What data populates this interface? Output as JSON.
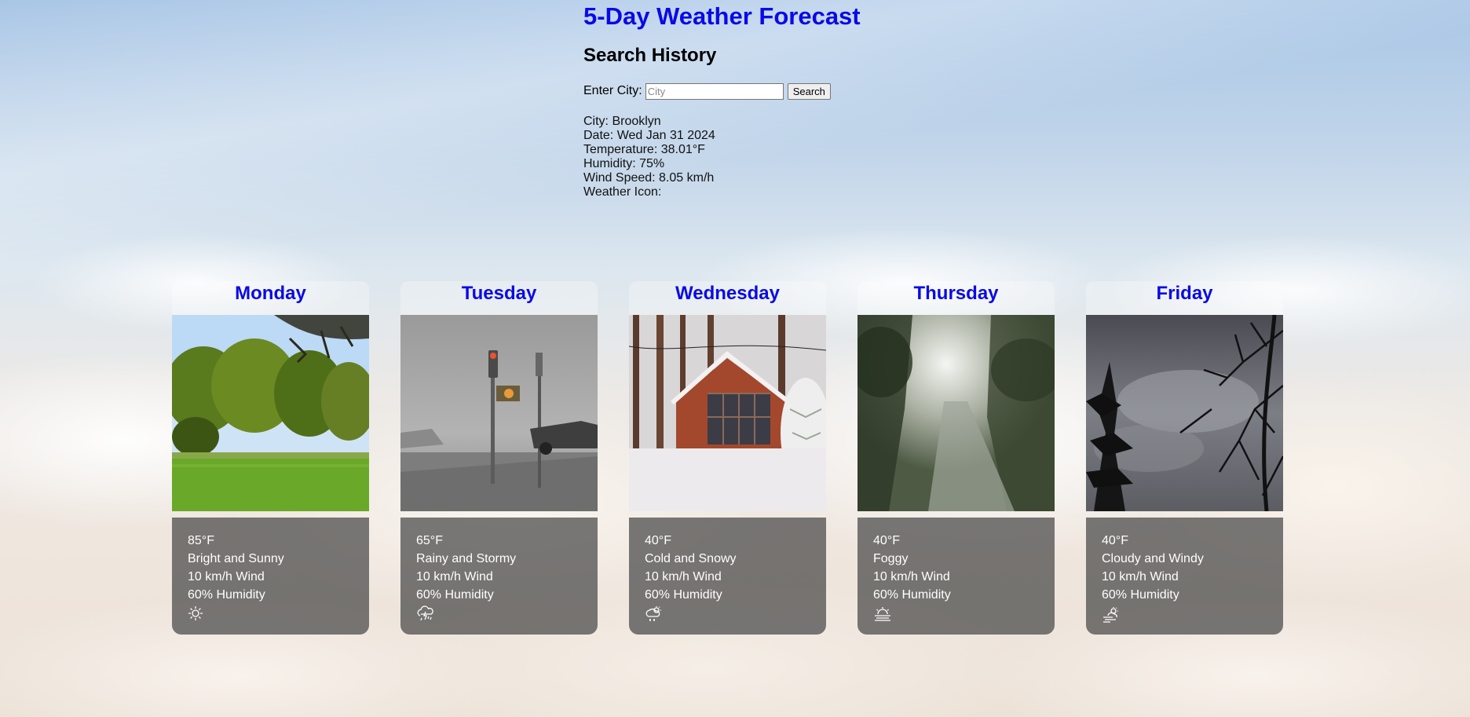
{
  "header": {
    "title": "5-Day Weather Forecast",
    "history_heading": "Search History"
  },
  "search": {
    "label": "Enter City:",
    "placeholder": "City",
    "value": "",
    "button_label": "Search"
  },
  "current": {
    "city": "City: Brooklyn",
    "date": "Date: Wed Jan 31 2024",
    "temperature": "Temperature: 38.01°F",
    "humidity": "Humidity: 75%",
    "wind": "Wind Speed: 8.05 km/h",
    "icon_label": "Weather Icon:"
  },
  "forecast": [
    {
      "day": "Monday",
      "temp": "85°F",
      "condition": "Bright and Sunny",
      "wind": "10 km/h Wind",
      "humidity": "60% Humidity",
      "icon": "sun-icon"
    },
    {
      "day": "Tuesday",
      "temp": "65°F",
      "condition": "Rainy and Stormy",
      "wind": "10 km/h Wind",
      "humidity": "60% Humidity",
      "icon": "storm-icon"
    },
    {
      "day": "Wednesday",
      "temp": "40°F",
      "condition": "Cold and Snowy",
      "wind": "10 km/h Wind",
      "humidity": "60% Humidity",
      "icon": "snow-icon"
    },
    {
      "day": "Thursday",
      "temp": "40°F",
      "condition": "Foggy",
      "wind": "10 km/h Wind",
      "humidity": "60% Humidity",
      "icon": "fog-icon"
    },
    {
      "day": "Friday",
      "temp": "40°F",
      "condition": "Cloudy and Windy",
      "wind": "10 km/h Wind",
      "humidity": "60% Humidity",
      "icon": "wind-icon"
    }
  ]
}
